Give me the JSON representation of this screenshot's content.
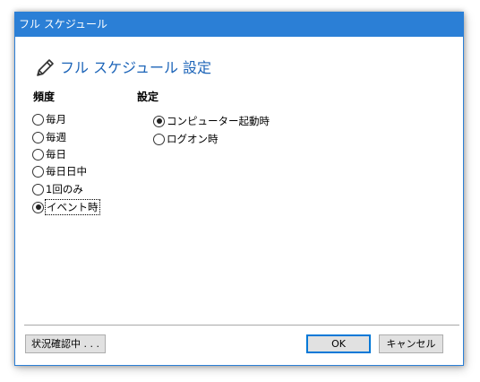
{
  "window": {
    "title": "フル スケジュール"
  },
  "heading": {
    "text": "フル スケジュール 設定",
    "icon": "pencil-icon"
  },
  "frequency": {
    "label": "頻度",
    "options": [
      "毎月",
      "毎週",
      "毎日",
      "毎日日中",
      "1回のみ",
      "イベント時"
    ],
    "selected": "イベント時"
  },
  "settings": {
    "label": "設定",
    "options": [
      "コンピューター起動時",
      "ログオン時"
    ],
    "selected": "コンピューター起動時"
  },
  "buttons": {
    "status": "状況確認中 . . .",
    "ok": "OK",
    "cancel": "キャンセル"
  },
  "colors": {
    "titlebar": "#2b7fd6",
    "heading": "#1c64b8"
  }
}
